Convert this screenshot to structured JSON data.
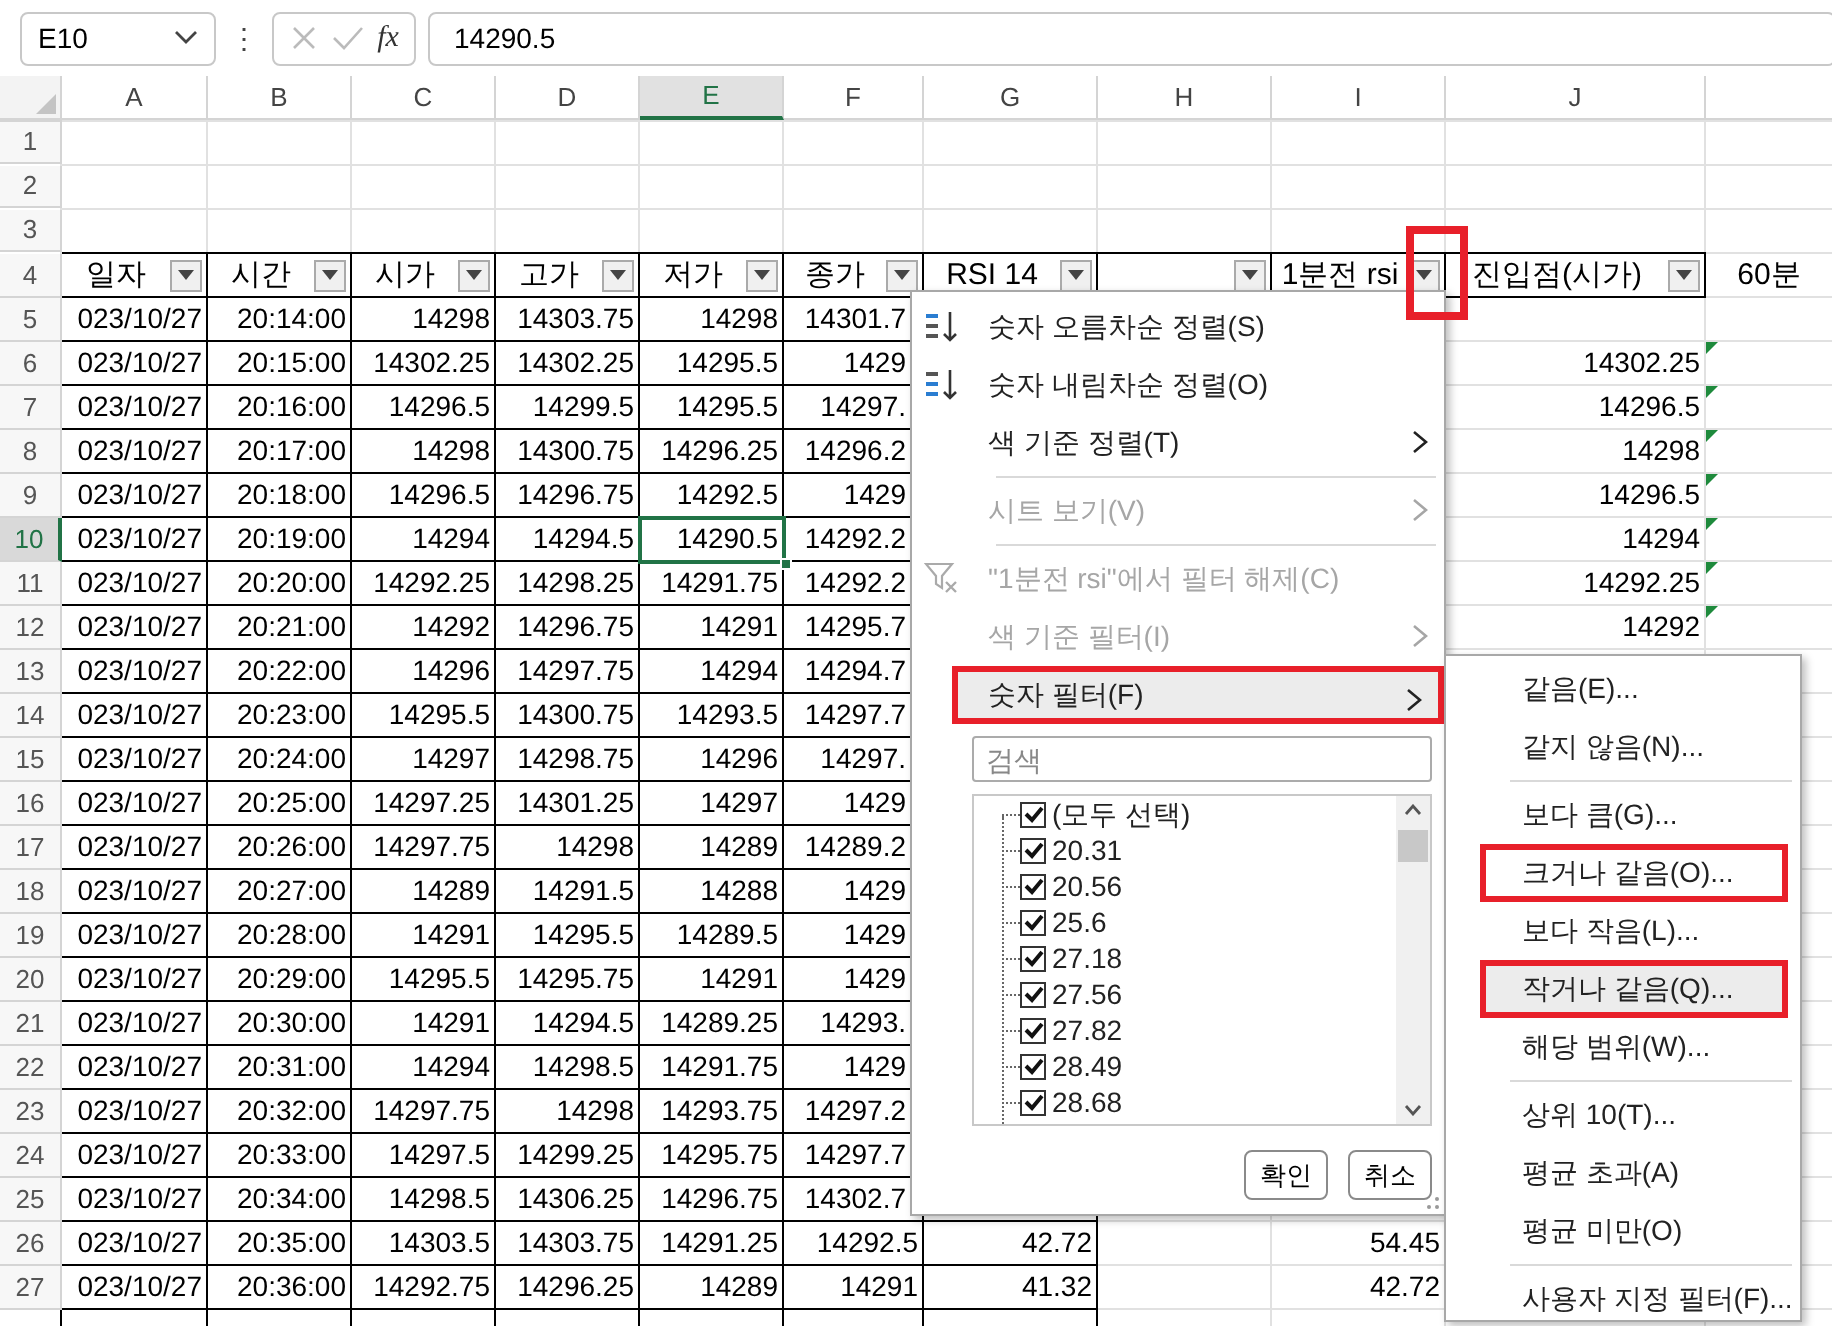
{
  "formula_bar": {
    "name_box": "E10",
    "more": "⋮",
    "function_label": "fx",
    "formula": "14290.5"
  },
  "columns": [
    {
      "letter": "A",
      "selected": false
    },
    {
      "letter": "B",
      "selected": false
    },
    {
      "letter": "C",
      "selected": false
    },
    {
      "letter": "D",
      "selected": false
    },
    {
      "letter": "E",
      "selected": true
    },
    {
      "letter": "F",
      "selected": false
    },
    {
      "letter": "G",
      "selected": false
    },
    {
      "letter": "H",
      "selected": false
    },
    {
      "letter": "I",
      "selected": false
    },
    {
      "letter": "J",
      "selected": false
    }
  ],
  "rows": [
    {
      "kind": "blank",
      "number": "1",
      "selected": false
    },
    {
      "kind": "blank",
      "number": "2",
      "selected": false
    },
    {
      "kind": "blank",
      "number": "3",
      "selected": false
    },
    {
      "kind": "header",
      "number": "4",
      "selected": false,
      "cells": [
        {
          "label": "일자",
          "filter_button": true,
          "annotated": false
        },
        {
          "label": "시간",
          "filter_button": true,
          "annotated": false
        },
        {
          "label": "시가",
          "filter_button": true,
          "annotated": false
        },
        {
          "label": "고가",
          "filter_button": true,
          "annotated": false
        },
        {
          "label": "저가",
          "filter_button": true,
          "annotated": false
        },
        {
          "label": "종가",
          "filter_button": true,
          "annotated": false
        },
        {
          "label": "RSI 14",
          "filter_button": true,
          "annotated": false
        },
        {
          "filter_button": true,
          "annotated": false
        },
        {
          "label": "1분전 rsi",
          "filter_button": true,
          "annotated": true
        },
        {
          "label": "진입점(시가)",
          "filter_button": true,
          "annotated": false
        },
        {
          "label": "60분",
          "filter_button": false
        }
      ]
    },
    {
      "kind": "data",
      "number": "5",
      "selected": false,
      "error_indicator": false,
      "cells": {
        "col_a": "023/10/27",
        "col_b": "20:14:00",
        "col_c": "14298",
        "col_d": "14303.75",
        "col_e": "14298",
        "col_f": "14301.7"
      }
    },
    {
      "kind": "data",
      "number": "6",
      "selected": false,
      "error_indicator": true,
      "cells": {
        "col_a": "023/10/27",
        "col_b": "20:15:00",
        "col_c": "14302.25",
        "col_d": "14302.25",
        "col_e": "14295.5",
        "col_f": "1429",
        "col_j": "14302.25"
      }
    },
    {
      "kind": "data",
      "number": "7",
      "selected": false,
      "error_indicator": true,
      "cells": {
        "col_a": "023/10/27",
        "col_b": "20:16:00",
        "col_c": "14296.5",
        "col_d": "14299.5",
        "col_e": "14295.5",
        "col_f": "14297.",
        "col_j": "14296.5"
      }
    },
    {
      "kind": "data",
      "number": "8",
      "selected": false,
      "error_indicator": true,
      "cells": {
        "col_a": "023/10/27",
        "col_b": "20:17:00",
        "col_c": "14298",
        "col_d": "14300.75",
        "col_e": "14296.25",
        "col_f": "14296.2",
        "col_j": "14298"
      }
    },
    {
      "kind": "data",
      "number": "9",
      "selected": false,
      "error_indicator": true,
      "cells": {
        "col_a": "023/10/27",
        "col_b": "20:18:00",
        "col_c": "14296.5",
        "col_d": "14296.75",
        "col_e": "14292.5",
        "col_f": "1429",
        "col_j": "14296.5"
      }
    },
    {
      "kind": "data",
      "number": "10",
      "selected": true,
      "error_indicator": true,
      "cells": {
        "col_a": "023/10/27",
        "col_b": "20:19:00",
        "col_c": "14294",
        "col_d": "14294.5",
        "col_e": "14290.5",
        "col_f": "14292.2",
        "col_j": "14294"
      }
    },
    {
      "kind": "data",
      "number": "11",
      "selected": false,
      "error_indicator": true,
      "cells": {
        "col_a": "023/10/27",
        "col_b": "20:20:00",
        "col_c": "14292.25",
        "col_d": "14298.25",
        "col_e": "14291.75",
        "col_f": "14292.2",
        "col_j": "14292.25"
      }
    },
    {
      "kind": "data",
      "number": "12",
      "selected": false,
      "error_indicator": true,
      "cells": {
        "col_a": "023/10/27",
        "col_b": "20:21:00",
        "col_c": "14292",
        "col_d": "14296.75",
        "col_e": "14291",
        "col_f": "14295.7",
        "col_j": "14292"
      }
    },
    {
      "kind": "data",
      "number": "13",
      "selected": false,
      "cells": {
        "col_a": "023/10/27",
        "col_b": "20:22:00",
        "col_c": "14296",
        "col_d": "14297.75",
        "col_e": "14294",
        "col_f": "14294.7"
      }
    },
    {
      "kind": "data",
      "number": "14",
      "selected": false,
      "cells": {
        "col_a": "023/10/27",
        "col_b": "20:23:00",
        "col_c": "14295.5",
        "col_d": "14300.75",
        "col_e": "14293.5",
        "col_f": "14297.7"
      }
    },
    {
      "kind": "data",
      "number": "15",
      "selected": false,
      "cells": {
        "col_a": "023/10/27",
        "col_b": "20:24:00",
        "col_c": "14297",
        "col_d": "14298.75",
        "col_e": "14296",
        "col_f": "14297."
      }
    },
    {
      "kind": "data",
      "number": "16",
      "selected": false,
      "cells": {
        "col_a": "023/10/27",
        "col_b": "20:25:00",
        "col_c": "14297.25",
        "col_d": "14301.25",
        "col_e": "14297",
        "col_f": "1429"
      }
    },
    {
      "kind": "data",
      "number": "17",
      "selected": false,
      "cells": {
        "col_a": "023/10/27",
        "col_b": "20:26:00",
        "col_c": "14297.75",
        "col_d": "14298",
        "col_e": "14289",
        "col_f": "14289.2"
      }
    },
    {
      "kind": "data",
      "number": "18",
      "selected": false,
      "cells": {
        "col_a": "023/10/27",
        "col_b": "20:27:00",
        "col_c": "14289",
        "col_d": "14291.5",
        "col_e": "14288",
        "col_f": "1429"
      }
    },
    {
      "kind": "data",
      "number": "19",
      "selected": false,
      "cells": {
        "col_a": "023/10/27",
        "col_b": "20:28:00",
        "col_c": "14291",
        "col_d": "14295.5",
        "col_e": "14289.5",
        "col_f": "1429"
      }
    },
    {
      "kind": "data",
      "number": "20",
      "selected": false,
      "cells": {
        "col_a": "023/10/27",
        "col_b": "20:29:00",
        "col_c": "14295.5",
        "col_d": "14295.75",
        "col_e": "14291",
        "col_f": "1429"
      }
    },
    {
      "kind": "data",
      "number": "21",
      "selected": false,
      "cells": {
        "col_a": "023/10/27",
        "col_b": "20:30:00",
        "col_c": "14291",
        "col_d": "14294.5",
        "col_e": "14289.25",
        "col_f": "14293."
      }
    },
    {
      "kind": "data",
      "number": "22",
      "selected": false,
      "cells": {
        "col_a": "023/10/27",
        "col_b": "20:31:00",
        "col_c": "14294",
        "col_d": "14298.5",
        "col_e": "14291.75",
        "col_f": "1429"
      }
    },
    {
      "kind": "data",
      "number": "23",
      "selected": false,
      "cells": {
        "col_a": "023/10/27",
        "col_b": "20:32:00",
        "col_c": "14297.75",
        "col_d": "14298",
        "col_e": "14293.75",
        "col_f": "14297.2"
      }
    },
    {
      "kind": "data",
      "number": "24",
      "selected": false,
      "cells": {
        "col_a": "023/10/27",
        "col_b": "20:33:00",
        "col_c": "14297.5",
        "col_d": "14299.25",
        "col_e": "14295.75",
        "col_f": "14297.7"
      }
    },
    {
      "kind": "data",
      "number": "25",
      "selected": false,
      "cells": {
        "col_a": "023/10/27",
        "col_b": "20:34:00",
        "col_c": "14298.5",
        "col_d": "14306.25",
        "col_e": "14296.75",
        "col_f": "14302.7"
      }
    },
    {
      "kind": "data",
      "number": "26",
      "selected": false,
      "cells": {
        "col_a": "023/10/27",
        "col_b": "20:35:00",
        "col_c": "14303.5",
        "col_d": "14303.75",
        "col_e": "14291.25",
        "col_f": "14292.5",
        "col_g": "42.72",
        "col_i": "54.45"
      }
    },
    {
      "kind": "data",
      "number": "27",
      "selected": false,
      "cells": {
        "col_a": "023/10/27",
        "col_b": "20:36:00",
        "col_c": "14292.75",
        "col_d": "14296.25",
        "col_e": "14289",
        "col_f": "14291",
        "col_g": "41.32",
        "col_i": "42.72"
      }
    }
  ],
  "filter_menu": {
    "items": [
      {
        "kind": "sort_ascending",
        "label": "숫자 오름차순 정렬(S)",
        "disabled": false,
        "submenu": false,
        "hovered": false,
        "annotated": false
      },
      {
        "kind": "sort_descending",
        "label": "숫자 내림차순 정렬(O)",
        "disabled": false,
        "submenu": false,
        "hovered": false,
        "annotated": false
      },
      {
        "kind": "item",
        "label": "색 기준 정렬(T)",
        "disabled": false,
        "submenu": true,
        "hovered": false,
        "annotated": false
      },
      {
        "kind": "separator"
      },
      {
        "kind": "item",
        "label": "시트 보기(V)",
        "disabled": true,
        "submenu": true,
        "hovered": false,
        "annotated": false
      },
      {
        "kind": "separator"
      },
      {
        "kind": "clear_filter",
        "label": "\"1분전 rsi\"에서 필터 해제(C)",
        "disabled": true,
        "submenu": false,
        "hovered": false,
        "annotated": false
      },
      {
        "kind": "item",
        "label": "색 기준 필터(I)",
        "disabled": true,
        "submenu": true,
        "hovered": false,
        "annotated": false
      },
      {
        "kind": "item",
        "label": "숫자 필터(F)",
        "disabled": false,
        "submenu": true,
        "hovered": true,
        "annotated": true
      }
    ],
    "search": {
      "placeholder": "검색"
    },
    "values": [
      {
        "label": "(모두 선택)",
        "checked": true
      },
      {
        "label": "20.31",
        "checked": true
      },
      {
        "label": "20.56",
        "checked": true
      },
      {
        "label": "25.6",
        "checked": true
      },
      {
        "label": "27.18",
        "checked": true
      },
      {
        "label": "27.56",
        "checked": true
      },
      {
        "label": "27.82",
        "checked": true
      },
      {
        "label": "28.49",
        "checked": true
      },
      {
        "label": "28.68",
        "checked": true
      }
    ],
    "buttons": [
      "확인",
      "취소"
    ]
  },
  "number_filter_menu": {
    "items": [
      {
        "kind": "item",
        "label": "같음(E)...",
        "hovered": false,
        "annotated": false
      },
      {
        "kind": "item",
        "label": "같지 않음(N)...",
        "hovered": false,
        "annotated": false
      },
      {
        "kind": "separator"
      },
      {
        "kind": "item",
        "label": "보다 큼(G)...",
        "hovered": false,
        "annotated": false
      },
      {
        "kind": "item",
        "label": "크거나 같음(O)...",
        "hovered": false,
        "annotated": true
      },
      {
        "kind": "item",
        "label": "보다 작음(L)...",
        "hovered": false,
        "annotated": false
      },
      {
        "kind": "item",
        "label": "작거나 같음(Q)...",
        "hovered": true,
        "annotated": true
      },
      {
        "kind": "item",
        "label": "해당 범위(W)...",
        "hovered": false,
        "annotated": false
      },
      {
        "kind": "separator"
      },
      {
        "kind": "item",
        "label": "상위 10(T)...",
        "hovered": false,
        "annotated": false
      },
      {
        "kind": "item",
        "label": "평균 초과(A)",
        "hovered": false,
        "annotated": false
      },
      {
        "kind": "item",
        "label": "평균 미만(O)",
        "hovered": false,
        "annotated": false
      },
      {
        "kind": "separator"
      },
      {
        "kind": "item",
        "label": "사용자 지정 필터(F)...",
        "hovered": false,
        "annotated": false
      }
    ]
  }
}
